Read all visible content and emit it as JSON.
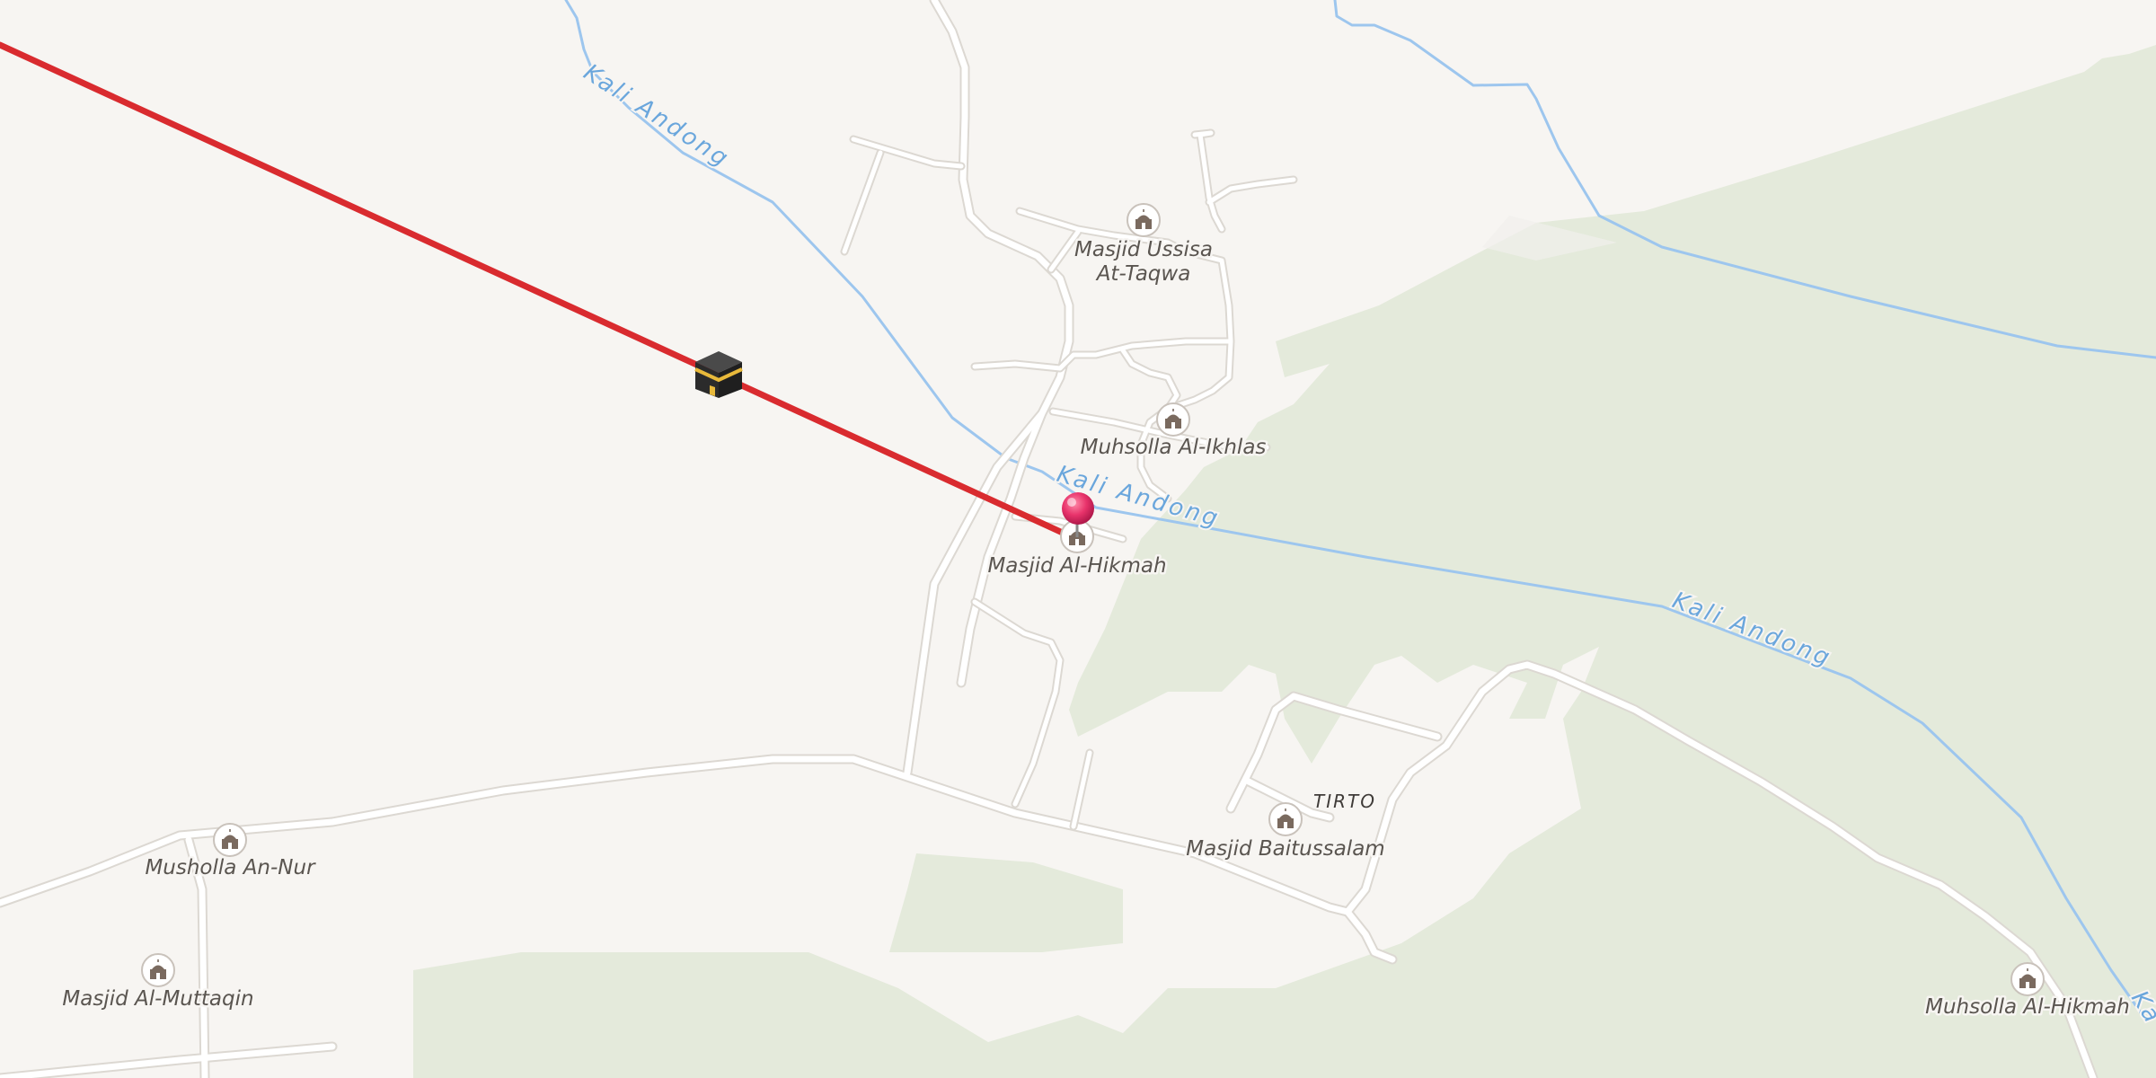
{
  "map": {
    "place_label": "TIRTO",
    "river_name": "Kali Andong",
    "river_name_partial": "Ka",
    "pois": [
      {
        "id": "masjid-ussisa",
        "label_line1": "Masjid Ussisa",
        "label_line2": "At-Taqwa",
        "icon": "mosque-icon"
      },
      {
        "id": "muhsolla-al-ikhlas",
        "label_line1": "Muhsolla Al-Ikhlas",
        "icon": "mosque-icon"
      },
      {
        "id": "masjid-al-hikmah",
        "label_line1": "Masjid Al-Hikmah",
        "icon": "mosque-icon"
      },
      {
        "id": "masjid-baitussalam",
        "label_line1": "Masjid Baitussalam",
        "icon": "mosque-icon"
      },
      {
        "id": "musholla-an-nur",
        "label_line1": "Musholla An-Nur",
        "icon": "mosque-icon"
      },
      {
        "id": "masjid-al-muttaqin",
        "label_line1": "Masjid Al-Muttaqin",
        "icon": "mosque-icon"
      },
      {
        "id": "muhsolla-al-hikmah",
        "label_line1": "Muhsolla Al-Hikmah",
        "icon": "mosque-icon"
      }
    ],
    "qibla_marker_icon": "kaaba-icon",
    "location_pin_icon": "location-pin-icon",
    "colors": {
      "land": "#f7f5f2",
      "forest": "#e4eadb",
      "road": "#ffffff",
      "road_casing": "#dcd8d2",
      "river": "#9dc6ee",
      "river_label": "#6aa6dc",
      "qibla_line": "#d92b2f",
      "pin": "#e8336b",
      "poi_icon": "#7a6a5f"
    }
  }
}
